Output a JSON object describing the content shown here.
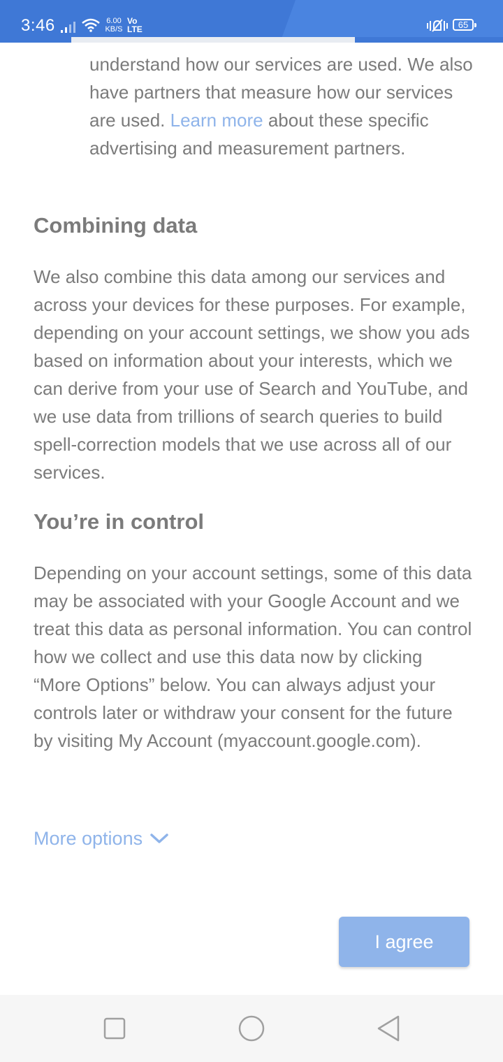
{
  "status_bar": {
    "time": "3:46",
    "speed_value": "6.00",
    "speed_unit": "KB/S",
    "network_top": "Vo",
    "network_bottom": "LTE",
    "battery": "65",
    "background_color": "#3f78d6"
  },
  "content": {
    "intro_paragraph": {
      "before_link": "understand how our services are used. We also have partners that measure how our services are used.",
      "link": "Learn more",
      "after_link": "about these specific advertising and measurement partners."
    },
    "combining_heading": "Combining data",
    "combining_paragraph": "We also combine this data among our services and across your devices for these purposes. For example, depending on your account settings, we show you ads based on information about your interests, which we can derive from your use of Search and YouTube, and we use data from trillions of search queries to build spell-correction models that we use across all of our services.",
    "control_heading": "You’re in control",
    "control_paragraph": "Depending on your account settings, some of this data may be associated with your Google Account and we treat this data as personal information. You can control how we collect and use this data now by clicking “More Options” below. You can always adjust your controls later or withdraw your consent for the future by visiting My Account (myaccount.google.com)."
  },
  "actions": {
    "more_options_label": "More options",
    "agree_label": "I agree",
    "accent_color": "#8fb4ea"
  },
  "nav_bar": {
    "icons": [
      "recents-square-icon",
      "home-circle-icon",
      "back-triangle-icon"
    ]
  }
}
